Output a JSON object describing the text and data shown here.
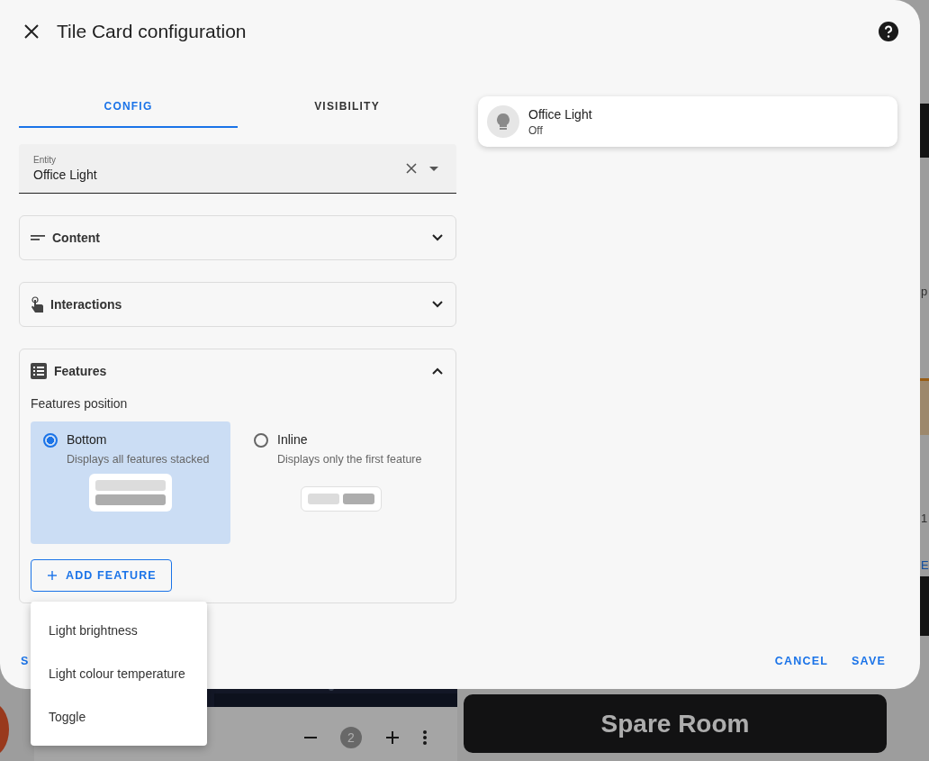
{
  "dialog": {
    "title": "Tile Card configuration"
  },
  "tabs": [
    {
      "label": "CONFIG",
      "selected": true
    },
    {
      "label": "VISIBILITY",
      "selected": false
    }
  ],
  "entity_field": {
    "label": "Entity",
    "value": "Office Light"
  },
  "sections": [
    {
      "title": "Content",
      "expanded": false
    },
    {
      "title": "Interactions",
      "expanded": false
    },
    {
      "title": "Features",
      "expanded": true
    }
  ],
  "features": {
    "position_label": "Features position",
    "options": [
      {
        "label": "Bottom",
        "description": "Displays all features stacked",
        "selected": true,
        "kind": "stacked"
      },
      {
        "label": "Inline",
        "description": "Displays only the first feature",
        "selected": false,
        "kind": "inline"
      }
    ],
    "add_button": "ADD FEATURE"
  },
  "menu": {
    "items": [
      "Light brightness",
      "Light colour temperature",
      "Toggle"
    ]
  },
  "footer": {
    "left_button": "S",
    "buttons": [
      "CANCEL",
      "SAVE"
    ]
  },
  "preview": {
    "name": "Office Light",
    "state": "Off"
  },
  "background": {
    "tile_title": "Spare Room",
    "counter": "2",
    "edge_texts": [
      "p",
      "1",
      "E"
    ]
  }
}
